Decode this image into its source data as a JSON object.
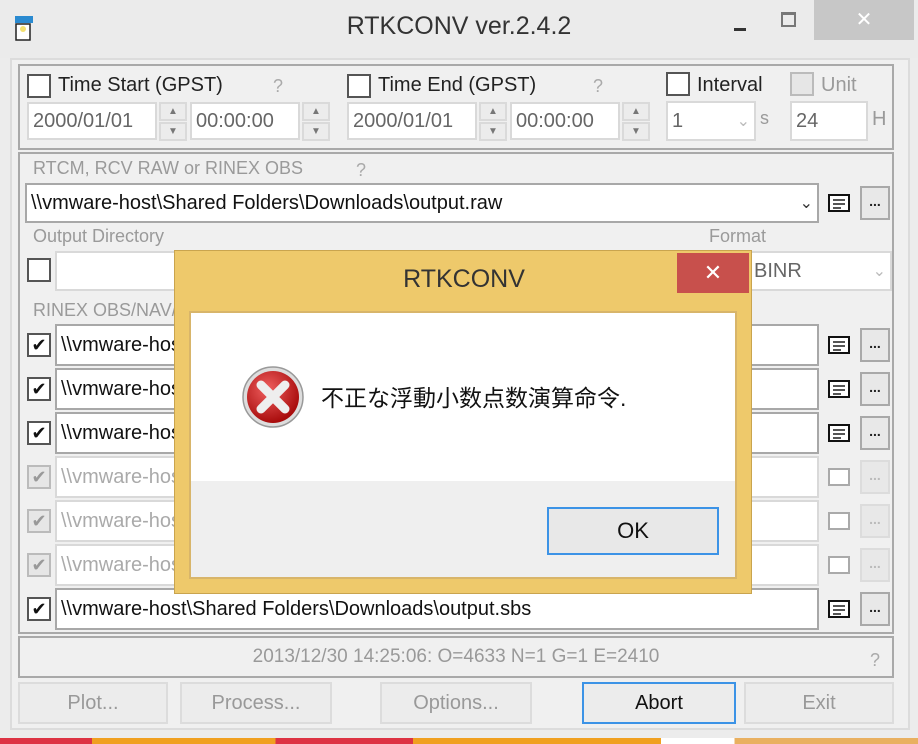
{
  "window": {
    "title": "RTKCONV ver.2.4.2",
    "icons": {
      "app": "rtkconv-app-icon",
      "minimize": "minimize-icon",
      "maximize": "maximize-icon",
      "close": "close-icon"
    },
    "close_glyph": "✕"
  },
  "time": {
    "start": {
      "label": "Time Start (GPST)",
      "checked": false,
      "date": "2000/01/01",
      "time": "00:00:00"
    },
    "end": {
      "label": "Time End (GPST)",
      "checked": false,
      "date": "2000/01/01",
      "time": "00:00:00"
    },
    "help": "?",
    "interval": {
      "label": "Interval",
      "checked": false,
      "value": "1",
      "unit": "s"
    },
    "unit": {
      "label": "Unit",
      "checked": false,
      "value": "24",
      "unit": "H"
    }
  },
  "input": {
    "label": "RTCM, RCV RAW or RINEX OBS",
    "help": "?",
    "value": "\\\\vmware-host\\Shared Folders\\Downloads\\output.raw",
    "browse": "..."
  },
  "output_dir": {
    "label": "Output Directory",
    "checked": false,
    "value": ""
  },
  "format": {
    "label": "Format",
    "value": "BINR"
  },
  "rinex": {
    "label": "RINEX OBS/NAV/GNAV/HNAV/QNAV/LNAV and SBS",
    "rows": [
      {
        "checked": true,
        "enabled": true,
        "value": "\\\\vmware-host\\Shared Folders\\Downloads\\output.obs"
      },
      {
        "checked": true,
        "enabled": true,
        "value": "\\\\vmware-host\\Shared Folders\\Downloads\\output.nav"
      },
      {
        "checked": true,
        "enabled": true,
        "value": "\\\\vmware-host\\Shared Folders\\Downloads\\output.gnav"
      },
      {
        "checked": true,
        "enabled": false,
        "value": "\\\\vmware-host\\Shared Folders\\Downloads\\output.hnav"
      },
      {
        "checked": true,
        "enabled": false,
        "value": "\\\\vmware-host\\Shared Folders\\Downloads\\output.qnav"
      },
      {
        "checked": true,
        "enabled": false,
        "value": "\\\\vmware-host\\Shared Folders\\Downloads\\output.lnav"
      },
      {
        "checked": true,
        "enabled": true,
        "value": "\\\\vmware-host\\Shared Folders\\Downloads\\output.sbs"
      }
    ],
    "browse": "..."
  },
  "status": {
    "text": "2013/12/30 14:25:06: O=4633 N=1 G=1 E=2410",
    "help": "?"
  },
  "buttons": {
    "plot": "Plot...",
    "process": "Process...",
    "options": "Options...",
    "abort": "Abort",
    "exit": "Exit"
  },
  "dialog": {
    "title": "RTKCONV",
    "close_glyph": "✕",
    "icon": "error-icon",
    "message": "不正な浮動小数点数演算命令.",
    "ok": "OK"
  },
  "check_glyph": "✔"
}
